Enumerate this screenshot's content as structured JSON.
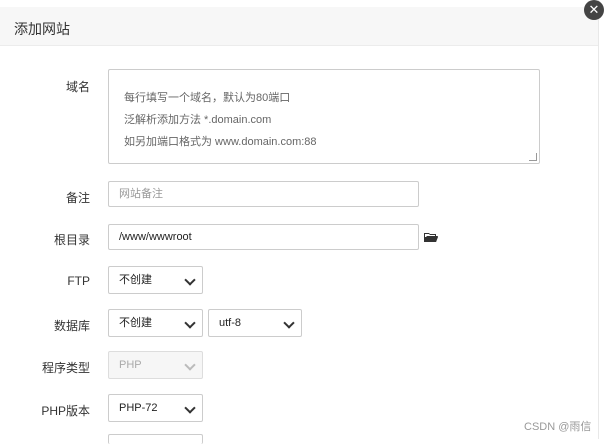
{
  "dialog": {
    "title": "添加网站",
    "close_icon": "close-icon"
  },
  "form": {
    "domain": {
      "label": "域名",
      "placeholder_lines": [
        "每行填写一个域名，默认为80端口",
        "泛解析添加方法 *.domain.com",
        "如另加端口格式为 www.domain.com:88"
      ]
    },
    "remark": {
      "label": "备注",
      "placeholder": "网站备注"
    },
    "root_dir": {
      "label": "根目录",
      "value": "/www/wwwroot",
      "icon": "folder-icon"
    },
    "ftp": {
      "label": "FTP",
      "selected": "不创建"
    },
    "database": {
      "label": "数据库",
      "selected": "不创建",
      "charset_selected": "utf-8"
    },
    "program_type": {
      "label": "程序类型",
      "selected": "PHP"
    },
    "php_version": {
      "label": "PHP版本",
      "selected": "PHP-72"
    }
  },
  "watermark": "CSDN @雨信",
  "colors": {
    "border": "#cccccc",
    "placeholder": "#999999",
    "title_bg": "#f7f7f7"
  }
}
